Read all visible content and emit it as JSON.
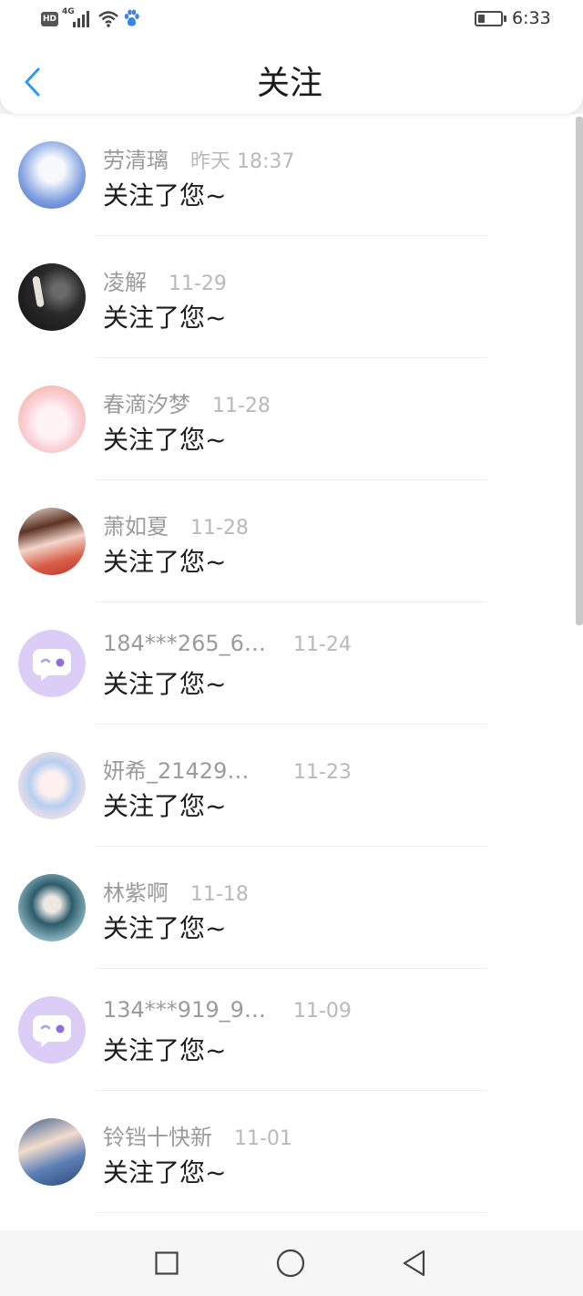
{
  "status_bar": {
    "hd": "HD",
    "network": "4G",
    "time": "6:33",
    "battery_level": 0.3
  },
  "header": {
    "title": "关注",
    "back_icon": "chevron-left-icon"
  },
  "colors": {
    "accent": "#2b9af3",
    "default_avatar": "#dccdf6"
  },
  "items": [
    {
      "name": "劳清璃",
      "time": "昨天 18:37",
      "message": "关注了您~"
    },
    {
      "name": "凌解",
      "time": "11-29",
      "message": "关注了您~"
    },
    {
      "name": "春滴汐梦",
      "time": "11-28",
      "message": "关注了您~"
    },
    {
      "name": "萧如夏",
      "time": "11-28",
      "message": "关注了您~"
    },
    {
      "name": "184***265_6…",
      "time": "11-24",
      "message": "关注了您~",
      "avatar_icon": "default-avatar-icon"
    },
    {
      "name": "妍希_21429…",
      "time": "11-23",
      "message": "关注了您~"
    },
    {
      "name": "林紫啊",
      "time": "11-18",
      "message": "关注了您~"
    },
    {
      "name": "134***919_9…",
      "time": "11-09",
      "message": "关注了您~",
      "avatar_icon": "default-avatar-icon"
    },
    {
      "name": "铃铛十快新",
      "time": "11-01",
      "message": "关注了您~"
    }
  ],
  "system_nav": {
    "recent_icon": "square-icon",
    "home_icon": "circle-icon",
    "back_icon": "triangle-back-icon"
  }
}
